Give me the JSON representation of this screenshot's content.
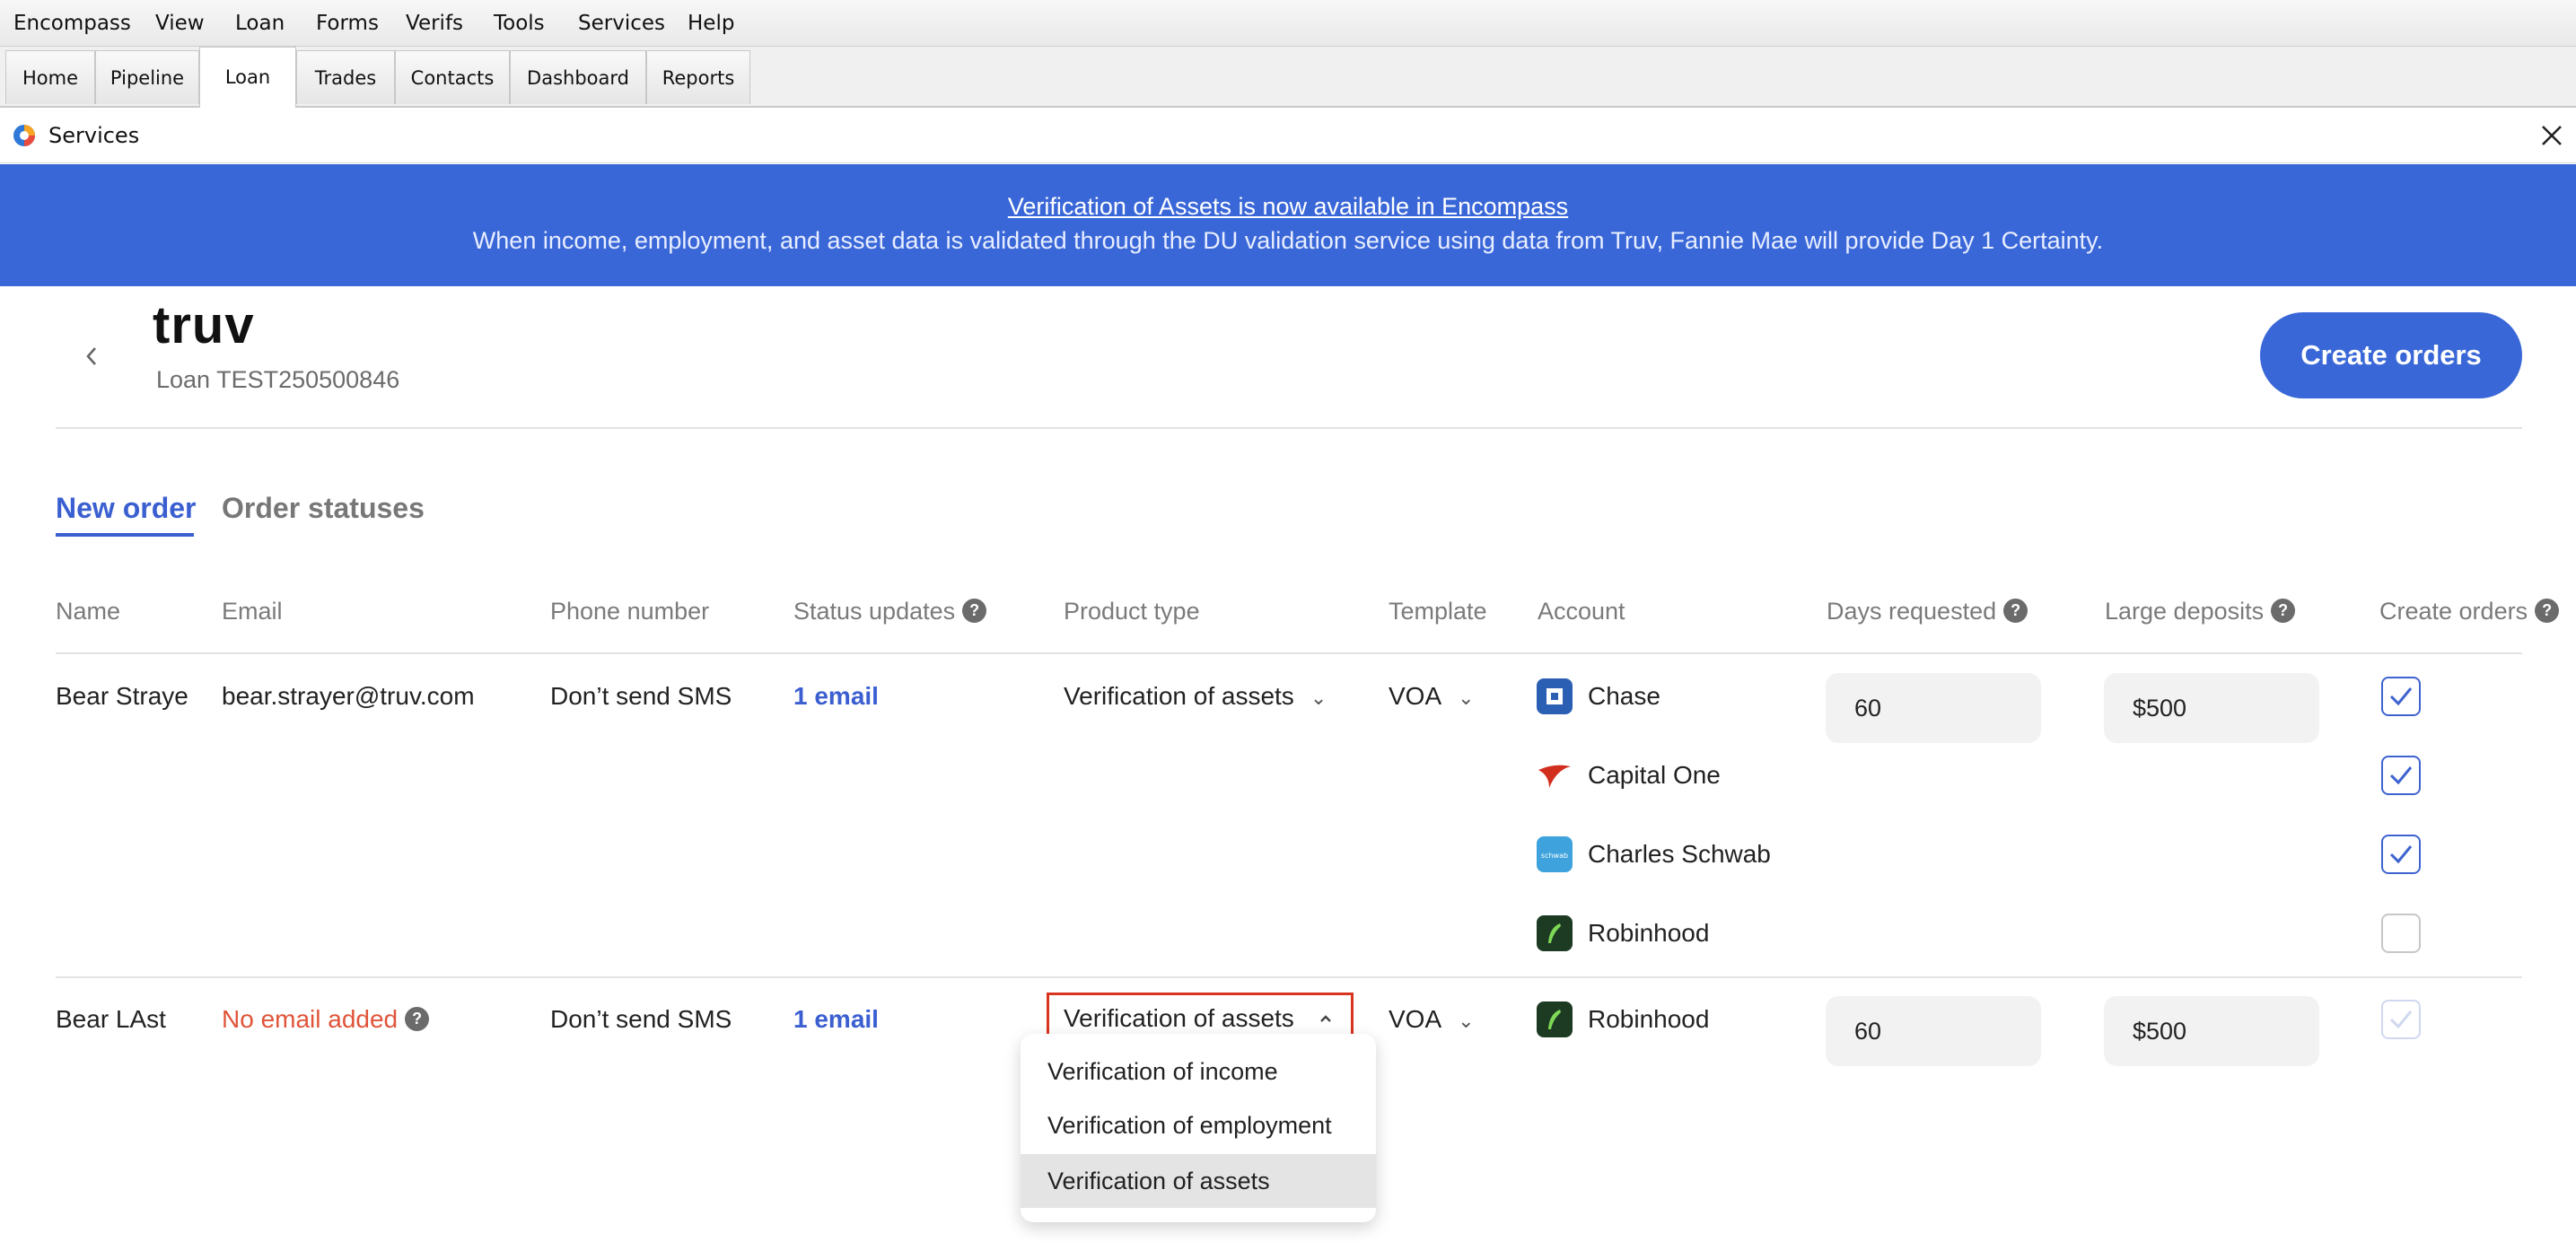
{
  "menu": [
    "Encompass",
    "View",
    "Loan",
    "Forms",
    "Verifs",
    "Tools",
    "Services",
    "Help"
  ],
  "tabs": [
    "Home",
    "Pipeline",
    "Loan",
    "Trades",
    "Contacts",
    "Dashboard",
    "Reports"
  ],
  "active_tab": "Loan",
  "window": {
    "title": "Services"
  },
  "banner": {
    "link_text": "Verification of Assets is now available in Encompass",
    "text": "When income, employment, and asset data is validated through the DU validation service using data from Truv, Fannie Mae will provide Day 1 Certainty."
  },
  "header": {
    "logo_text": "truv",
    "loan_label": "Loan TEST250500846",
    "create_button": "Create orders"
  },
  "order_tabs": {
    "new_order": "New order",
    "order_statuses": "Order statuses"
  },
  "columns": {
    "name": "Name",
    "email": "Email",
    "phone": "Phone number",
    "status_updates": "Status updates",
    "product_type": "Product type",
    "template": "Template",
    "account": "Account",
    "days_requested": "Days requested",
    "large_deposits": "Large deposits",
    "create_orders": "Create orders"
  },
  "rows": [
    {
      "name": "Bear Straye",
      "email": "bear.strayer@truv.com",
      "phone": "Don’t send SMS",
      "status_updates": "1 email",
      "product_type": "Verification of assets",
      "template": "VOA",
      "days_requested": "60",
      "large_deposits": "$500",
      "accounts": [
        {
          "name": "Chase",
          "icon": "chase-logo-icon",
          "checked": true
        },
        {
          "name": "Capital One",
          "icon": "capital-one-logo-icon",
          "checked": true
        },
        {
          "name": "Charles Schwab",
          "icon": "charles-schwab-logo-icon",
          "checked": true
        },
        {
          "name": "Robinhood",
          "icon": "robinhood-logo-icon",
          "checked": false
        }
      ]
    },
    {
      "name": "Bear LAst",
      "email": "No email added",
      "email_error": true,
      "phone": "Don’t send SMS",
      "status_updates": "1 email",
      "product_type": "Verification of assets",
      "template": "VOA",
      "days_requested": "60",
      "large_deposits": "$500",
      "accounts": [
        {
          "name": "Robinhood",
          "icon": "robinhood-logo-icon",
          "checked": true,
          "disabled": true
        }
      ]
    }
  ],
  "dropdown": {
    "options": [
      "Verification of income",
      "Verification of employment",
      "Verification of assets"
    ],
    "selected": "Verification of assets"
  },
  "colors": {
    "accent": "#3a67d8",
    "link": "#3b5fd0",
    "error": "#e0543a",
    "highlight_border": "#d9341f"
  }
}
